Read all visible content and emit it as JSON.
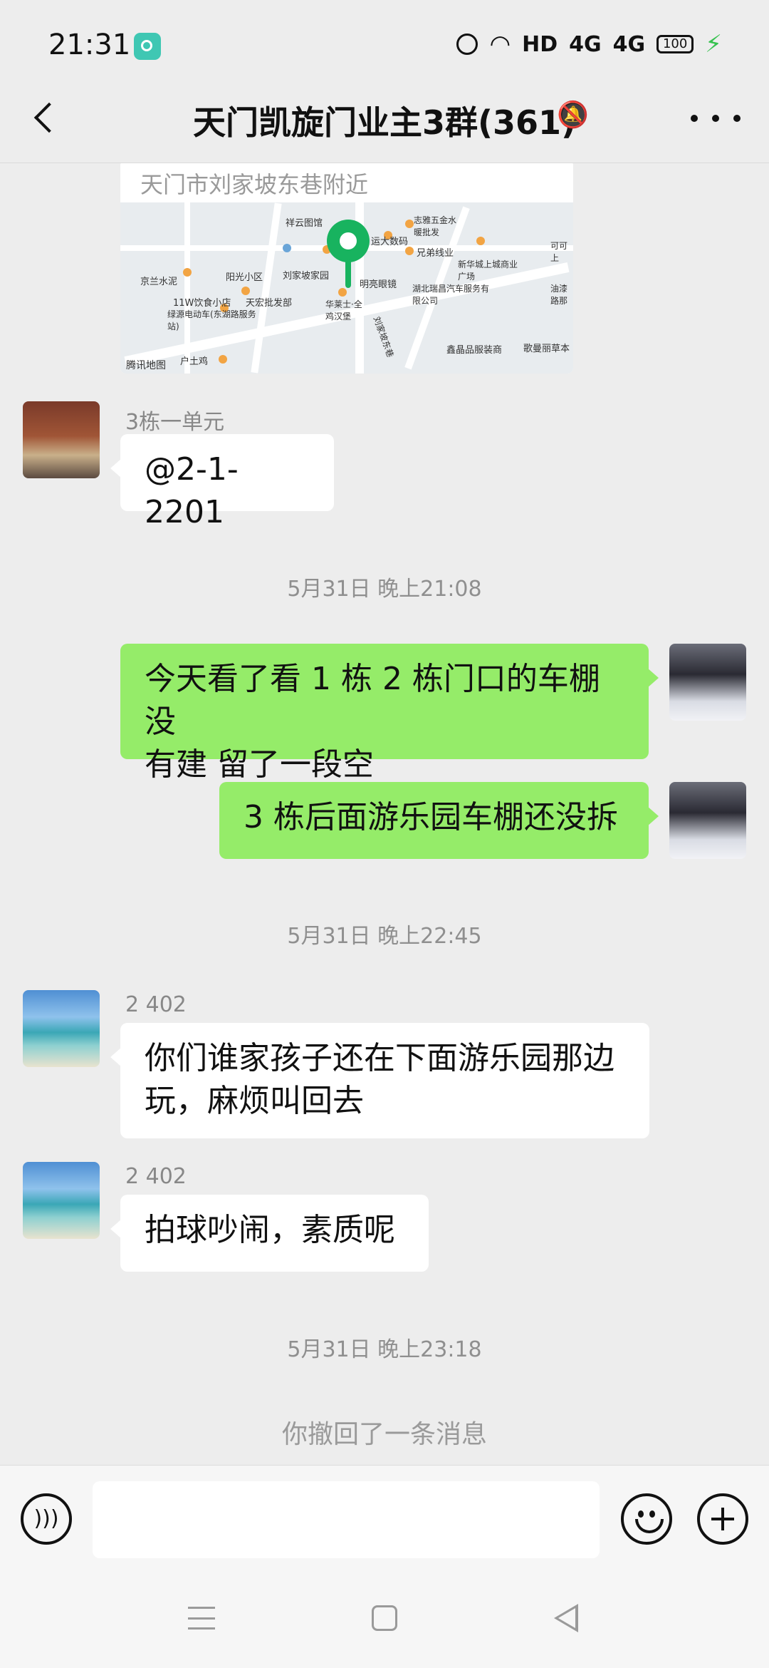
{
  "status_bar": {
    "time": "21:31",
    "network": "HD",
    "signal_1": "4G",
    "signal_2": "4G",
    "battery": "100"
  },
  "nav": {
    "title": "天门凯旋门业主3群(361)"
  },
  "location_card": {
    "address": "天门市刘家坡东巷附近",
    "map_brand": "腾讯地图",
    "map_labels": [
      "祥云图馆",
      "志雅五金水暖批发",
      "运大数码",
      "兄弟线业",
      "新华城上城商业广场",
      "可可上",
      "京兰水泥",
      "阳光小区",
      "刘家坡家园",
      "明亮眼镜",
      "湖北瑞昌汽车服务有限公司",
      "油漆路那",
      "11W饮食小店",
      "天宏批发部",
      "华莱士·全鸡汉堡",
      "绿源电动车(东湖路服务站)",
      "刘家坡东巷",
      "鑫晶品服装商",
      "歌曼丽草本",
      "户土鸡"
    ]
  },
  "messages": [
    {
      "sender": "3栋一单元",
      "text": "@2-1-2201"
    },
    {
      "time": "5月31日 晚上21:08"
    },
    {
      "text": "今天看了看 1 栋 2 栋门口的车棚没有建 留了一段空",
      "line1": "今天看了看 1 栋 2 栋门口的车棚没",
      "line2": "有建 留了一段空"
    },
    {
      "text": "3 栋后面游乐园车棚还没拆"
    },
    {
      "time": "5月31日 晚上22:45"
    },
    {
      "sender": "2 402",
      "line1": "你们谁家孩子还在下面游乐园那边",
      "line2": "玩，麻烦叫回去"
    },
    {
      "sender": "2 402",
      "text": "拍球吵闹，素质呢"
    },
    {
      "time": "5月31日 晚上23:18"
    },
    {
      "system": "你撤回了一条消息"
    }
  ],
  "input": {
    "value": ""
  }
}
